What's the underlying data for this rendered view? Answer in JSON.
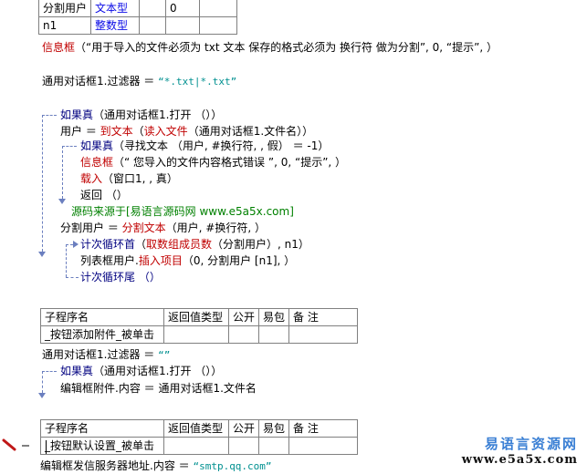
{
  "top_table": {
    "rows": [
      {
        "name": "分割用户",
        "type": "文本型",
        "c3": "",
        "c4": "0",
        "c5": ""
      },
      {
        "name": "n1",
        "type": "整数型",
        "c3": "",
        "c4": "",
        "c5": ""
      }
    ]
  },
  "code": {
    "l_msgbox_1_func": "信息框",
    "l_msgbox_1_args": "（“用于导入的文件必须为 txt 文本  保存的格式必须为 换行符 做为分割”, 0, “提示”, ）",
    "l_filter_1_lhs": "通用对话框1.过滤器 ＝ ",
    "l_filter_1_str": "“*.txt|*.txt”",
    "l_if_1_kw": "如果真",
    "l_if_1_args": "（通用对话框1.打开 （））",
    "l_user_lhs": "用户 ＝ ",
    "l_user_func1": "到文本",
    "l_user_paren": "（",
    "l_user_func2": "读入文件",
    "l_user_args": "（通用对话框1.文件名））",
    "l_if_2_kw": "如果真",
    "l_if_2_args": "（寻找文本 （用户, #换行符, , 假） ＝ -1）",
    "l_msgbox_2_func": "信息框",
    "l_msgbox_2_args": "（“ 您导入的文件内容格式错误  ”, 0, “提示”, ）",
    "l_load_func": "载入",
    "l_load_args": "（窗口1, , 真）",
    "l_return": "返回 （）",
    "l_comment": "源码来源于[易语言源码网 www.e5a5x.com]",
    "l_split_lhs": "分割用户 ＝ ",
    "l_split_func": "分割文本",
    "l_split_args": "（用户, #换行符, ）",
    "l_loop_kw": "计次循环首",
    "l_loop_paren": "（",
    "l_loop_func": "取数组成员数",
    "l_loop_args": "（分割用户）, n1）",
    "l_list_lhs": "列表框用户.",
    "l_list_func": "插入项目",
    "l_list_args": "（0, 分割用户 [n1], ）",
    "l_loop_end": "计次循环尾 （）"
  },
  "sub_table_1": {
    "headers": [
      "子程序名",
      "返回值类型",
      "公开",
      "易包",
      "备 注"
    ],
    "name": "_按钮添加附件_被单击"
  },
  "code2": {
    "l_filter_lhs": "通用对话框1.过滤器 ＝ ",
    "l_filter_str": "“”",
    "l_if_kw": "如果真",
    "l_if_args": "（通用对话框1.打开 （））",
    "l_edit_line": "编辑框附件.内容 ＝ 通用对话框1.文件名"
  },
  "sub_table_2": {
    "headers": [
      "子程序名",
      "返回值类型",
      "公开",
      "易包",
      "备 注"
    ],
    "name": "_按钮默认设置_被单击"
  },
  "code3": {
    "l_server_lhs": "编辑框发信服务器地址.内容 ＝ ",
    "l_server_str": "“smtp.qq.com”"
  },
  "watermark": {
    "line1": "易语言资源网",
    "line2": "www.e5a5x.com"
  },
  "colors": {
    "func_red": "#c00000",
    "type_blue": "#0a0ae6",
    "keyword_navy": "#000080",
    "comment_green": "#008000",
    "string_teal": "#009090",
    "flow_line": "#6b7fbf"
  }
}
